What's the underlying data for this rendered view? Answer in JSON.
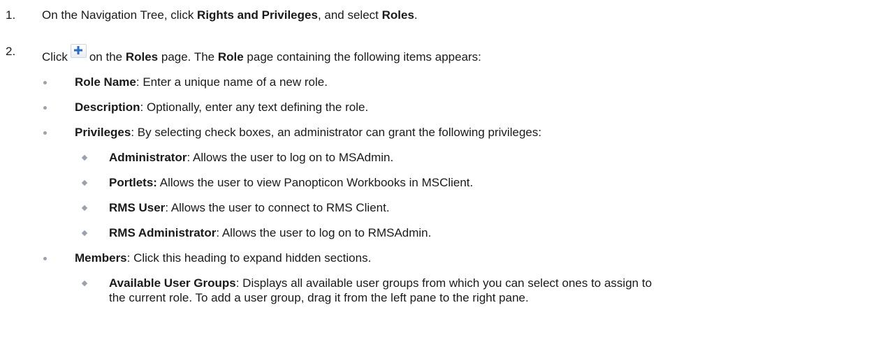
{
  "steps": [
    {
      "num": "1.",
      "parts": [
        "On the Navigation Tree, click ",
        "Rights and Privileges",
        ", and select ",
        "Roles",
        "."
      ]
    },
    {
      "num": "2.",
      "pre": "Click",
      "post_a": "on the ",
      "roles": "Roles",
      "post_b": " page. The ",
      "role": "Role",
      "post_c": " page containing the following items appears:",
      "icon": "plus-icon"
    }
  ],
  "items": [
    {
      "label": "Role Name",
      "text": ": Enter a unique name of a new role."
    },
    {
      "label": "Description",
      "text": ": Optionally, enter any text defining the role."
    },
    {
      "label": "Privileges",
      "text": ": By selecting check boxes, an administrator can grant the following privileges:"
    },
    {
      "label": "Members",
      "text": ": Click this heading to expand hidden sections."
    }
  ],
  "privileges": [
    {
      "label": "Administrator",
      "text": ": Allows the user to log on to MSAdmin."
    },
    {
      "label": "Portlets:",
      "text": " Allows the user to view Panopticon Workbooks in MSClient."
    },
    {
      "label": "RMS User",
      "text": ": Allows the user to connect to RMS Client."
    },
    {
      "label": "RMS Administrator",
      "text": ": Allows the user to log on to RMSAdmin."
    }
  ],
  "members": [
    {
      "label": "Available User Groups",
      "text": ": Displays all available user groups from which you can select ones to assign to",
      "text2": "the current role. To add a user group, drag it from the left pane to the right pane."
    }
  ],
  "colors": {
    "text": "#1a1a1a",
    "bullet": "#9aa3ad",
    "plus_icon": "#2b6cc4"
  }
}
